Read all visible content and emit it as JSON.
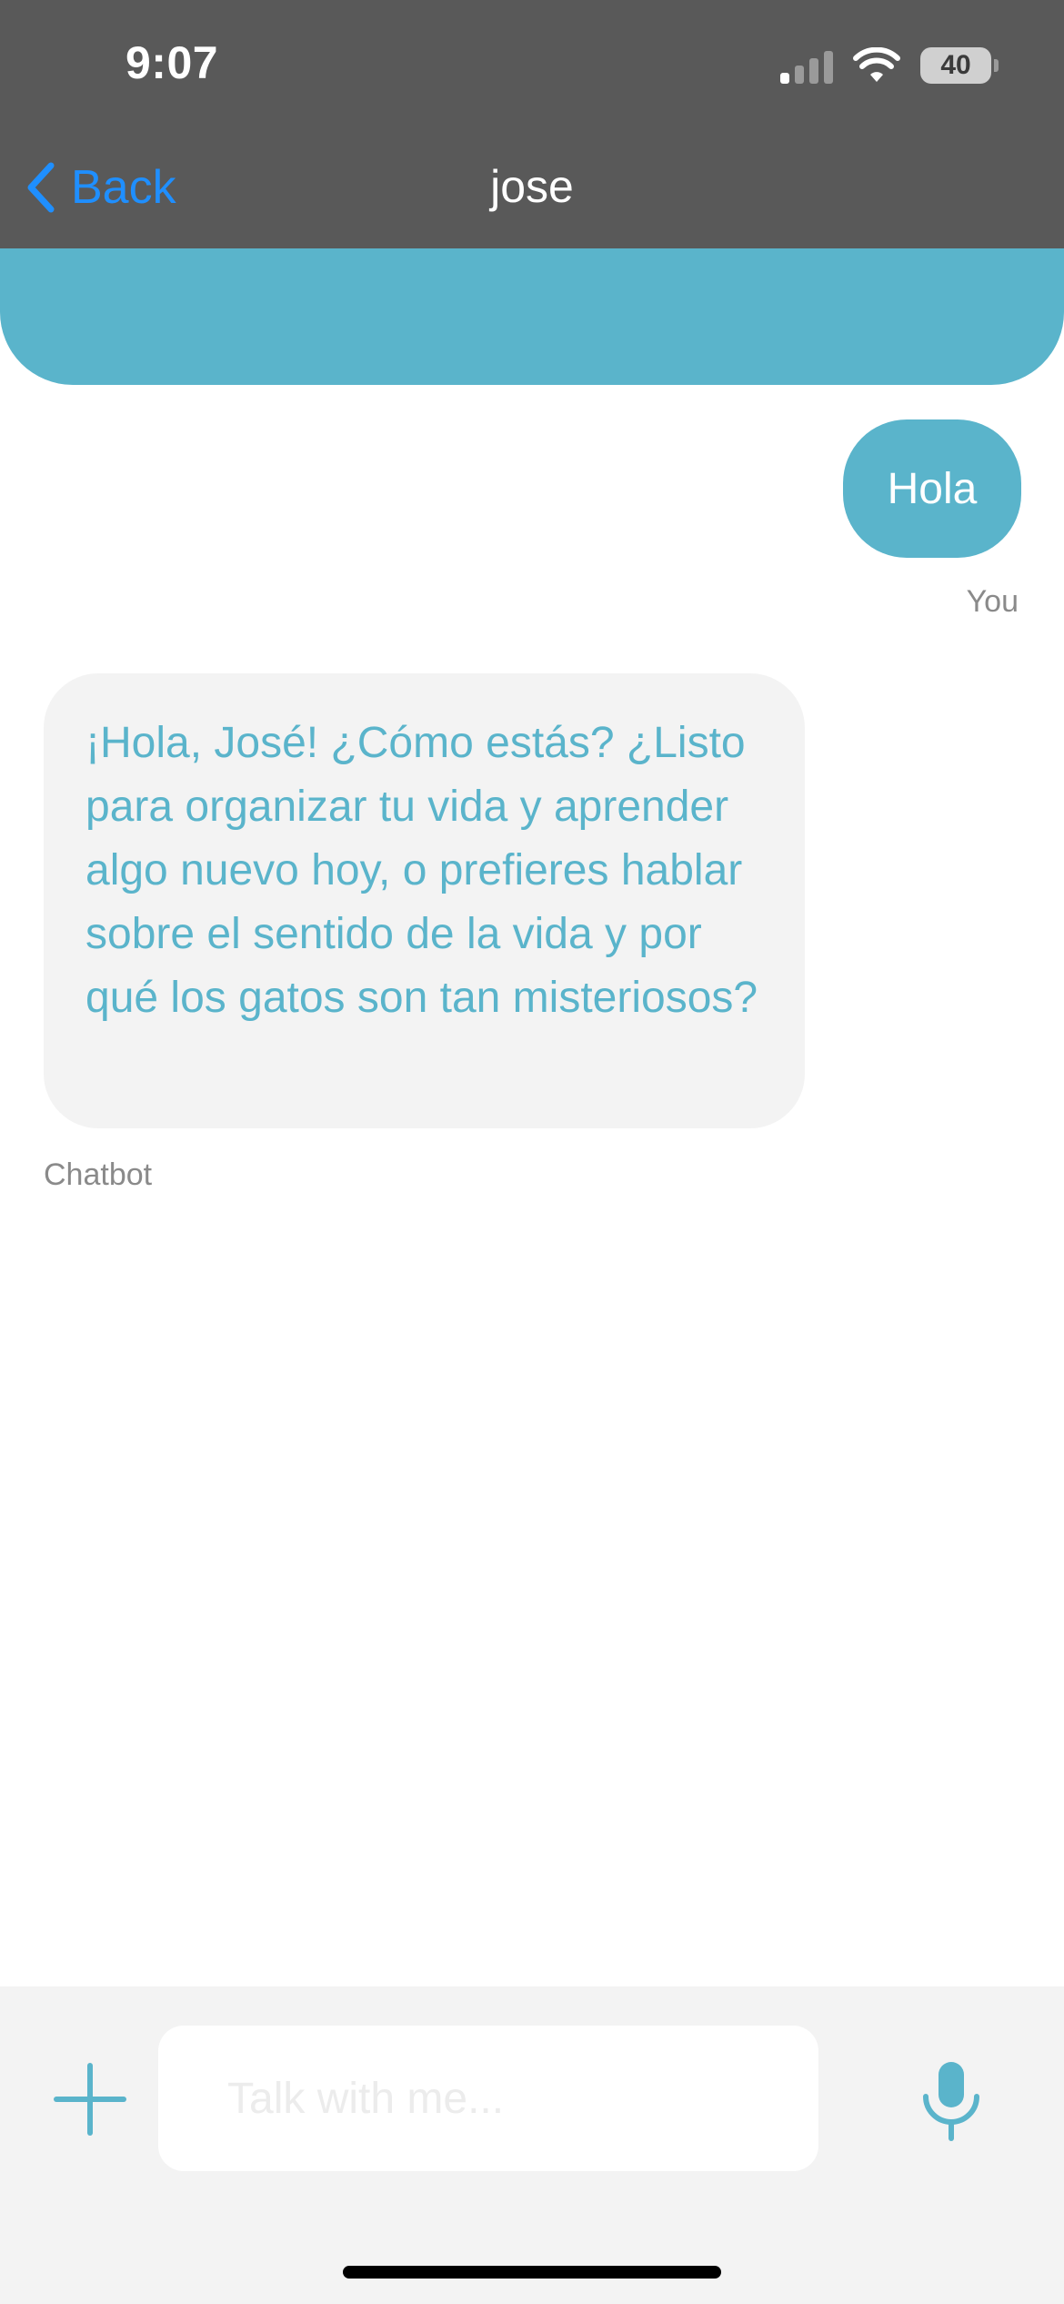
{
  "status_bar": {
    "time": "9:07",
    "battery_level": "40"
  },
  "nav": {
    "back_label": "Back",
    "title": "jose"
  },
  "messages": [
    {
      "sender": "You",
      "text": "Hola"
    },
    {
      "sender": "Chatbot",
      "text": "¡Hola, José! ¿Cómo estás? ¿Listo para organizar tu vida y aprender algo nuevo hoy, o prefieres hablar sobre el sentido de la vida y por qué los gatos son tan misteriosos?"
    }
  ],
  "composer": {
    "placeholder": "Talk with me..."
  },
  "colors": {
    "accent": "#5ab4cb",
    "header_bg": "#595959",
    "link_blue": "#1f8fff",
    "bot_bubble_bg": "#f3f3f3",
    "input_bar_bg": "#f3f3f3"
  },
  "icons": {
    "back": "chevron-left-icon",
    "signal": "cellular-signal-icon",
    "wifi": "wifi-icon",
    "battery": "battery-icon",
    "attach": "plus-icon",
    "voice": "microphone-icon"
  }
}
